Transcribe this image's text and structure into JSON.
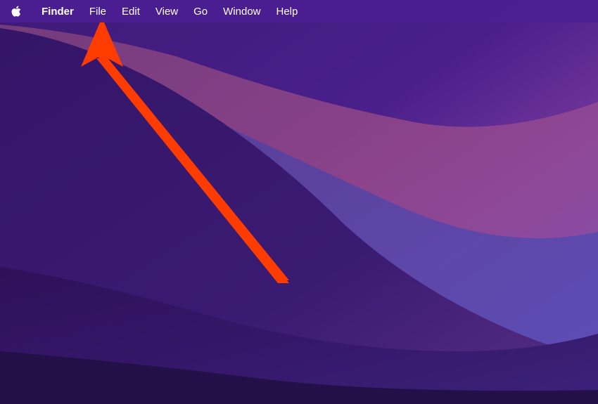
{
  "menubar": {
    "app_name": "Finder",
    "items": [
      "File",
      "Edit",
      "View",
      "Go",
      "Window",
      "Help"
    ]
  }
}
